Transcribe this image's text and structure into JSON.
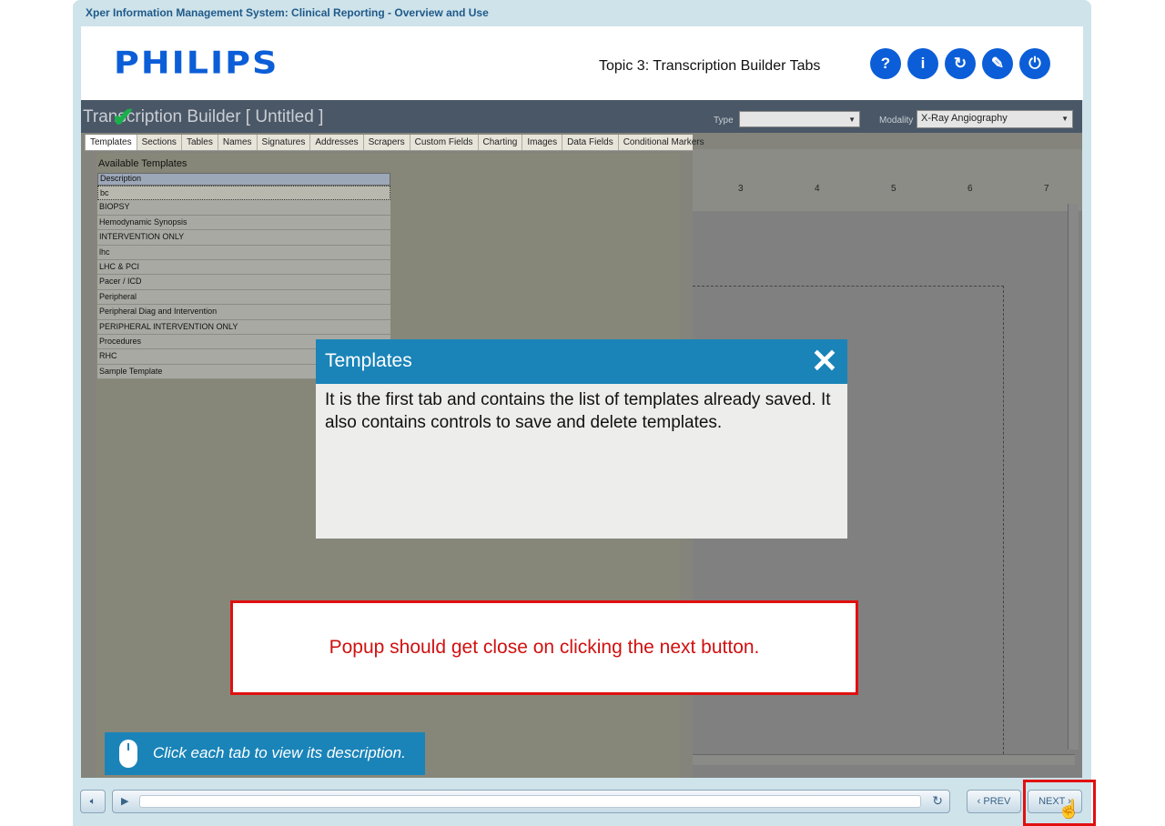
{
  "course": {
    "title": "Xper Information Management System: Clinical Reporting - Overview and Use",
    "logo_text": "PHILIPS",
    "topic": "Topic 3: Transcription Builder Tabs",
    "header_buttons": [
      {
        "name": "help",
        "glyph": "?"
      },
      {
        "name": "info",
        "glyph": "i"
      },
      {
        "name": "replay",
        "glyph": "↻"
      },
      {
        "name": "navigate",
        "glyph": "✎"
      },
      {
        "name": "exit",
        "glyph": "⏻"
      }
    ],
    "accent_color": "#0b5ed7"
  },
  "app": {
    "title": "Transcription Builder [ Untitled ]",
    "type_label": "Type",
    "type_value": "",
    "modality_label": "Modality",
    "modality_value": "X-Ray Angiography",
    "tabs": [
      "Templates",
      "Sections",
      "Tables",
      "Names",
      "Signatures",
      "Addresses",
      "Scrapers",
      "Custom Fields",
      "Charting",
      "Images",
      "Data Fields",
      "Conditional Markers"
    ],
    "active_tab": "Templates",
    "available_label": "Available Templates",
    "list_header": "Description",
    "templates": [
      "bc",
      "BIOPSY",
      "Hemodynamic Synopsis",
      "INTERVENTION ONLY",
      "lhc",
      "LHC & PCI",
      "Pacer / ICD",
      "Peripheral",
      "Peripheral Diag and Intervention",
      "PERIPHERAL INTERVENTION ONLY",
      "Procedures",
      "RHC",
      "Sample Template"
    ],
    "ruler_marks": [
      "3",
      "4",
      "5",
      "6",
      "7"
    ]
  },
  "popup": {
    "title": "Templates",
    "body": "It is the first tab and contains the list of templates already saved. It also contains controls to save and delete templates.",
    "header_color": "#1a84b8"
  },
  "note": {
    "text": "Popup should get close on clicking the next button.",
    "color": "#e01010"
  },
  "hint": {
    "text": "Click each tab to view its description."
  },
  "footer": {
    "prev_label": "PREV",
    "next_label": "NEXT",
    "progress": 0.0
  }
}
